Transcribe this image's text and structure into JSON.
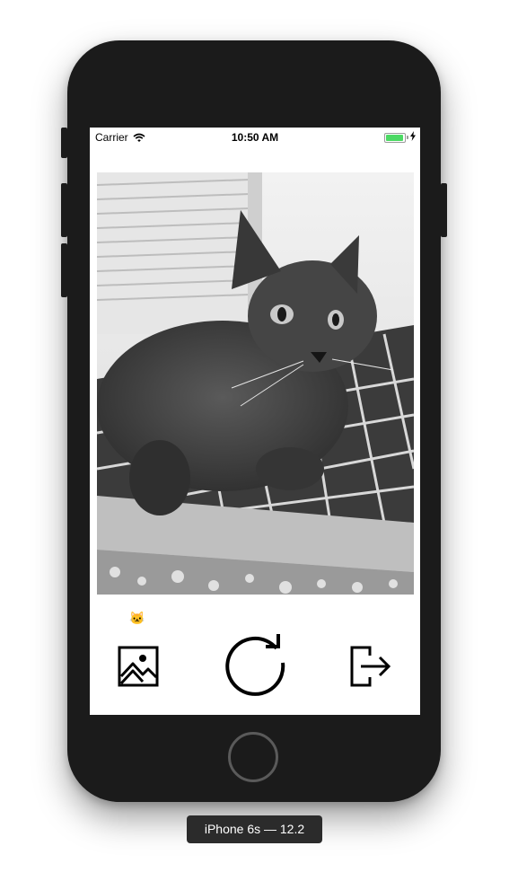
{
  "status_bar": {
    "carrier": "Carrier",
    "time": "10:50 AM"
  },
  "photo": {
    "description_icon": "cat-photo"
  },
  "emoji_badge": "🐱",
  "toolbar": {
    "gallery_icon": "image-gallery-icon",
    "refresh_icon": "refresh-icon",
    "exit_icon": "exit-icon"
  },
  "simulator": {
    "device_label": "iPhone 6s — 12.2"
  },
  "colors": {
    "battery": "#4cd964",
    "device": "#1b1b1b"
  }
}
